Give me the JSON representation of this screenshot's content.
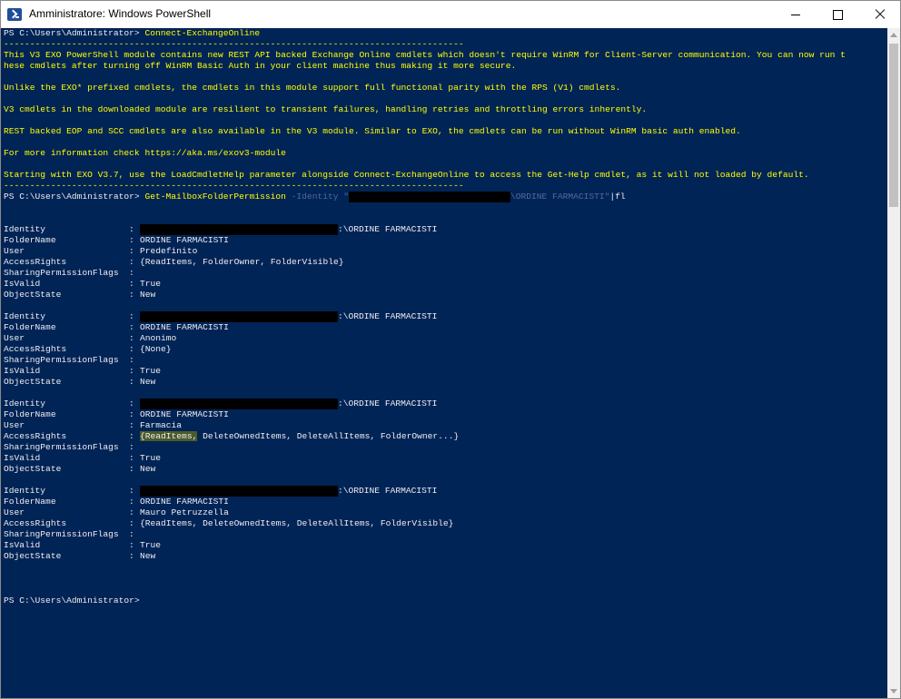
{
  "window": {
    "title": "Amministratore: Windows PowerShell",
    "icon": "powershell-icon",
    "controls": [
      "minimize-icon",
      "maximize-icon",
      "close-icon"
    ]
  },
  "colors": {
    "console_bg": "#012456",
    "text": "#eeedf0",
    "warning_text": "#ffff00",
    "parameter_text": "#4f6a9b"
  },
  "console": {
    "prompt1": "PS C:\\Users\\Administrator> ",
    "command1": "Connect-ExchangeOnline",
    "separator": "----------------------------------------------------------------------------------------",
    "banner": [
      "This V3 EXO PowerShell module contains new REST API backed Exchange Online cmdlets which doesn't require WinRM for Client-Server communication. You can now run t",
      "hese cmdlets after turning off WinRM Basic Auth in your client machine thus making it more secure.",
      "Unlike the EXO* prefixed cmdlets, the cmdlets in this module support full functional parity with the RPS (V1) cmdlets.",
      "V3 cmdlets in the downloaded module are resilient to transient failures, handling retries and throttling errors inherently.",
      "REST backed EOP and SCC cmdlets are also available in the V3 module. Similar to EXO, the cmdlets can be run without WinRM basic auth enabled.",
      "For more information check https://aka.ms/exov3-module",
      "Starting with EXO V3.7, use the LoadCmdletHelp parameter alongside Connect-ExchangeOnline to access the Get-Help cmdlet, as it will not loaded by default."
    ],
    "prompt2": "PS C:\\Users\\Administrator> ",
    "command2": "Get-MailboxFolderPermission",
    "param_identity": " -Identity \"",
    "identity_suffix": "\\ORDINE FARMACISTI\"",
    "pipe_fl": "|fl",
    "labels": {
      "identity": "Identity",
      "folder_name": "FolderName",
      "user": "User",
      "access_rights": "AccessRights",
      "sharing_flags": "SharingPermissionFlags",
      "is_valid": "IsValid",
      "object_state": "ObjectState",
      "sep": ":"
    },
    "entries": [
      {
        "identity_suffix": ":\\ORDINE FARMACISTI",
        "folder_name": "ORDINE FARMACISTI",
        "user": "Predefinito",
        "access_rights": "{ReadItems, FolderOwner, FolderVisible}",
        "sharing_flags": "",
        "is_valid": "True",
        "object_state": "New"
      },
      {
        "identity_suffix": ":\\ORDINE FARMACISTI",
        "folder_name": "ORDINE FARMACISTI",
        "user": "Anonimo",
        "access_rights": "{None}",
        "sharing_flags": "",
        "is_valid": "True",
        "object_state": "New"
      },
      {
        "identity_suffix": ":\\ORDINE FARMACISTI",
        "folder_name": "ORDINE FARMACISTI",
        "user": "Farmacia",
        "access_rights_highlight": "{ReadItems,",
        "access_rights_rest": " DeleteOwnedItems, DeleteAllItems, FolderOwner...}",
        "sharing_flags": "",
        "is_valid": "True",
        "object_state": "New"
      },
      {
        "identity_suffix": ":\\ORDINE FARMACISTI",
        "folder_name": "ORDINE FARMACISTI",
        "user": "Mauro Petruzzella",
        "access_rights": "{ReadItems, DeleteOwnedItems, DeleteAllItems, FolderVisible}",
        "sharing_flags": "",
        "is_valid": "True",
        "object_state": "New"
      }
    ],
    "prompt_final": "PS C:\\Users\\Administrator>"
  }
}
